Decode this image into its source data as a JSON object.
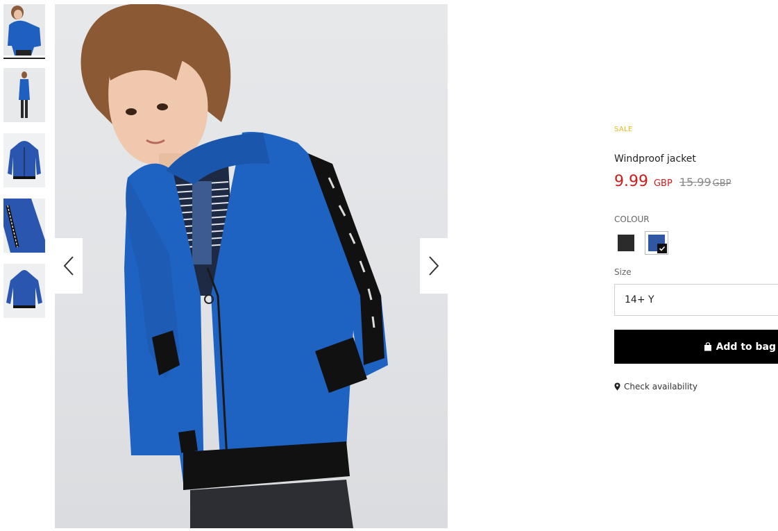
{
  "gallery": {
    "thumbnails": [
      {
        "name": "thumbnail-front-model",
        "active": true
      },
      {
        "name": "thumbnail-side-model",
        "active": false
      },
      {
        "name": "thumbnail-flat-front",
        "active": false
      },
      {
        "name": "thumbnail-sleeve-detail",
        "active": false
      },
      {
        "name": "thumbnail-flat-back",
        "active": false
      }
    ],
    "prev_icon": "chevron-left-icon",
    "next_icon": "chevron-right-icon"
  },
  "product": {
    "badge": "SALE",
    "name": "Windproof jacket",
    "price_now": "9.99",
    "currency_now": "GBP",
    "price_old": "15.99",
    "currency_old": "GBP"
  },
  "colour": {
    "label": "COLOUR",
    "options": [
      {
        "name": "black",
        "hex": "#2b2b2b",
        "selected": false
      },
      {
        "name": "blue",
        "hex": "#2f57a3",
        "selected": true
      }
    ]
  },
  "size": {
    "label": "Size",
    "selected": "14+ Y"
  },
  "actions": {
    "add_to_bag": "Add to bag",
    "check_availability": "Check availability"
  },
  "colors": {
    "sale_badge": "#e8b71b",
    "price_sale": "#cc1d1d",
    "price_old": "#888888",
    "button_bg": "#000000",
    "jacket_blue": "#1f63c2"
  }
}
